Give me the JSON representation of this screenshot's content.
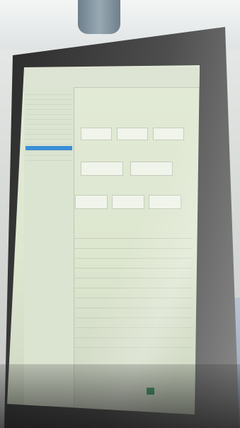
{
  "scene": {
    "description_note": "",
    "device": "kiosk"
  },
  "screen": {
    "top_bar_items": [
      "",
      "",
      "",
      ""
    ],
    "panel_title": "",
    "sidebar_items": [
      "",
      "",
      "",
      "",
      "",
      "",
      "",
      "",
      "",
      "",
      "",
      "",
      "",
      ""
    ],
    "button_rows": [
      [
        "",
        "",
        ""
      ],
      [
        "",
        ""
      ],
      [
        "",
        "",
        ""
      ]
    ],
    "table_rows": [
      {
        "label": "",
        "value": ""
      },
      {
        "label": "",
        "value": ""
      },
      {
        "label": "",
        "value": ""
      },
      {
        "label": "",
        "value": ""
      },
      {
        "label": "",
        "value": ""
      },
      {
        "label": "",
        "value": ""
      },
      {
        "label": "",
        "value": ""
      },
      {
        "label": "",
        "value": ""
      },
      {
        "label": "",
        "value": ""
      },
      {
        "label": "",
        "value": ""
      },
      {
        "label": "",
        "value": ""
      },
      {
        "label": "",
        "value": ""
      }
    ],
    "status_color": "#2e8b57",
    "active_accent": "#3b8fd6"
  }
}
